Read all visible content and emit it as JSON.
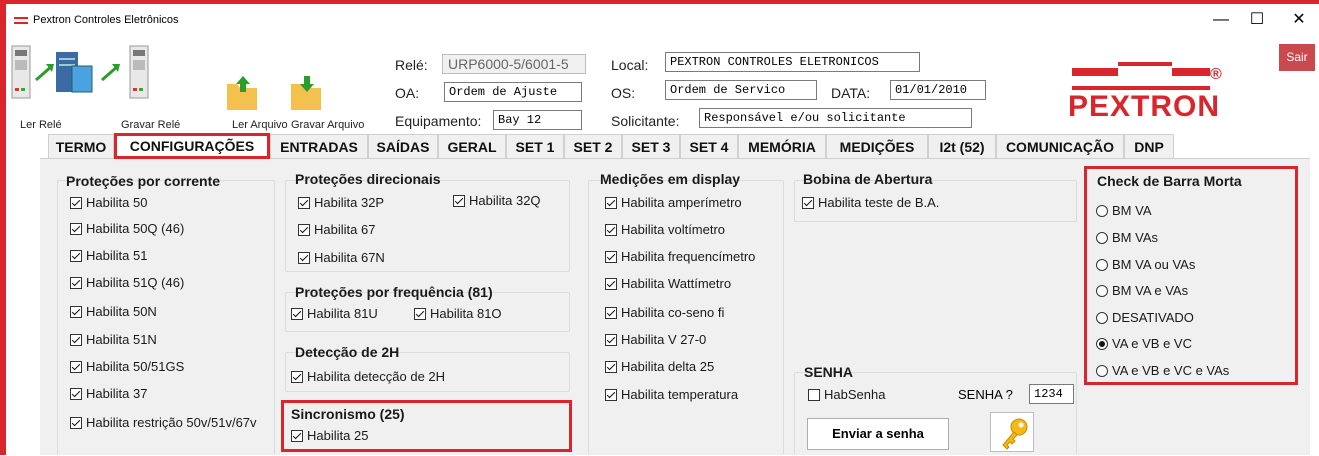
{
  "window": {
    "title": "Pextron Controles Eletrônicos",
    "minimize": "—",
    "maximize": "☐",
    "close": "✕"
  },
  "toolbar": {
    "ler_rele": "Ler Relé",
    "gravar_rele": "Gravar Relé",
    "ler_arquivo": "Ler Arquivo",
    "gravar_arquivo": "Gravar Arquivo"
  },
  "header": {
    "rele_label": "Relé:",
    "rele_value": "URP6000-5/6001-5",
    "oa_label": "OA:",
    "oa_value": "Ordem de Ajuste",
    "equip_label": "Equipamento:",
    "equip_value": "Bay 12",
    "local_label": "Local:",
    "local_value": "PEXTRON CONTROLES ELETRONICOS",
    "os_label": "OS:",
    "os_value": "Ordem de Servico",
    "data_label": "DATA:",
    "data_value": "01/01/2010",
    "solic_label": "Solicitante:",
    "solic_value": "Responsável e/ou solicitante"
  },
  "logo": {
    "text": "PEXTRON",
    "reg": "®"
  },
  "sair": "Sair",
  "tabs": [
    "TERMO",
    "CONFIGURAÇÕES",
    "ENTRADAS",
    "SAÍDAS",
    "GERAL",
    "SET 1",
    "SET 2",
    "SET 3",
    "SET 4",
    "MEMÓRIA",
    "MEDIÇÕES",
    "I2t (52)",
    "COMUNICAÇÃO",
    "DNP"
  ],
  "protecoes_corrente": {
    "title": "Proteções por corrente",
    "items": [
      "Habilita 50",
      "Habilita 50Q (46)",
      "Habilita 51",
      "Habilita 51Q (46)",
      "Habilita 50N",
      "Habilita 51N",
      "Habilita 50/51GS",
      "Habilita 37",
      "Habilita restrição 50v/51v/67v"
    ]
  },
  "protecoes_direcionais": {
    "title": "Proteções direcionais",
    "items": [
      "Habilita 32P",
      "Habilita 32Q",
      "Habilita 67",
      "Habilita 67N"
    ]
  },
  "protecoes_frequencia": {
    "title": "Proteções por frequência (81)",
    "items": [
      "Habilita 81U",
      "Habilita 81O"
    ]
  },
  "deteccao_2h": {
    "title": "Detecção de 2H",
    "items": [
      "Habilita detecção de 2H"
    ]
  },
  "sincronismo": {
    "title": "Sincronismo (25)",
    "items": [
      "Habilita 25"
    ]
  },
  "medicoes_display": {
    "title": "Medições em display",
    "items": [
      "Habilita amperímetro",
      "Habilita voltímetro",
      "Habilita frequencímetro",
      "Habilita Wattímetro",
      "Habilita co-seno fi",
      "Habilita V 27-0",
      "Habilita delta 25",
      "Habilita temperatura"
    ]
  },
  "bobina": {
    "title": "Bobina de Abertura",
    "items": [
      "Habilita teste de B.A."
    ]
  },
  "senha": {
    "title": "SENHA",
    "hab_label": "HabSenha",
    "senha_label": "SENHA ?",
    "senha_value": "1234",
    "enviar": "Enviar a senha"
  },
  "barra_morta": {
    "title": "Check de Barra Morta",
    "options": [
      "BM VA",
      "BM VAs",
      "BM VA ou VAs",
      "BM VA e VAs",
      "DESATIVADO",
      "VA e VB e VC",
      "VA e VB e VC e VAs"
    ],
    "selected": "VA e VB e VC"
  }
}
